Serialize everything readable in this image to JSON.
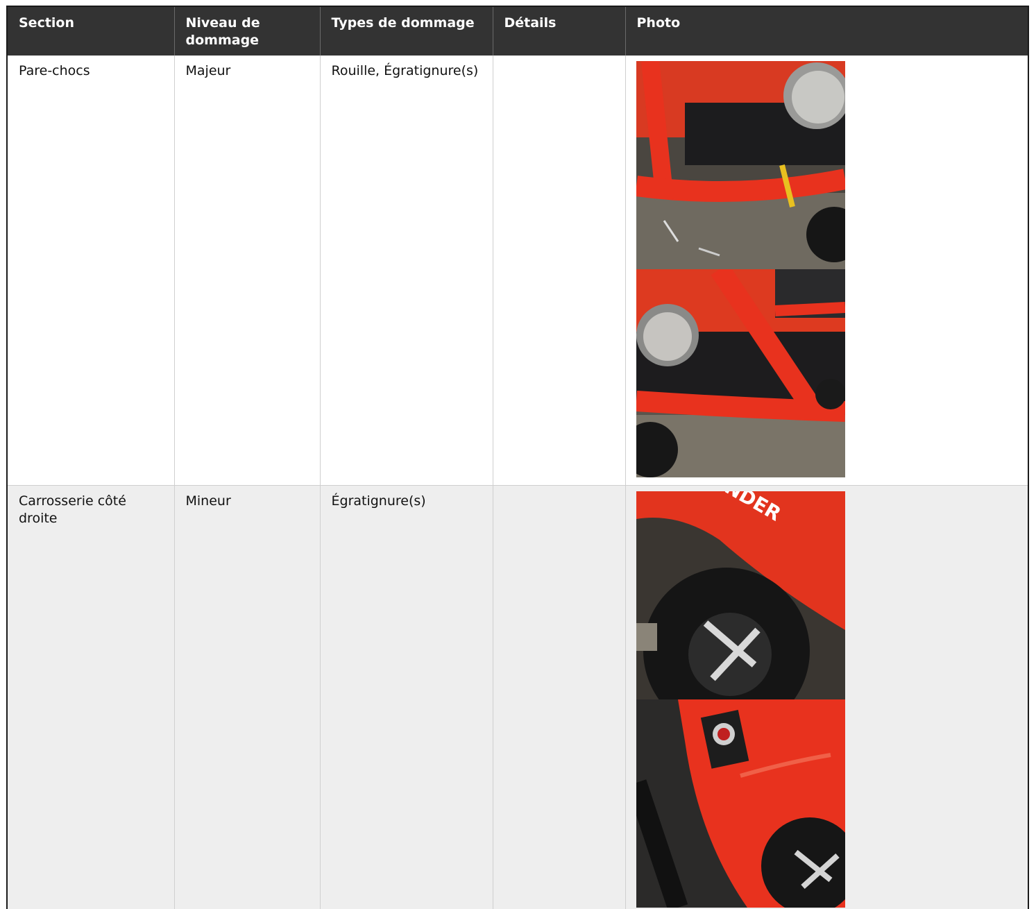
{
  "table": {
    "headers": [
      "Section",
      "Niveau de dommage",
      "Types de dommage",
      "Détails",
      "Photo"
    ],
    "rows": [
      {
        "section": "Pare-chocs",
        "level": "Majeur",
        "types": "Rouille, Égratignure(s)",
        "details": "",
        "photos": [
          "front-bumper-photo",
          "front-bumper-photo"
        ]
      },
      {
        "section": "Carrosserie côté droite",
        "level": "Mineur",
        "types": "Égratignure(s)",
        "details": "",
        "photos": [
          "right-body-photo",
          "right-body-photo"
        ]
      }
    ]
  },
  "photo_text": {
    "decal": "TLANDER"
  },
  "colors": {
    "header_bg": "#333333",
    "row_alt_bg": "#eeeeee",
    "vehicle_red": "#e8321e"
  }
}
